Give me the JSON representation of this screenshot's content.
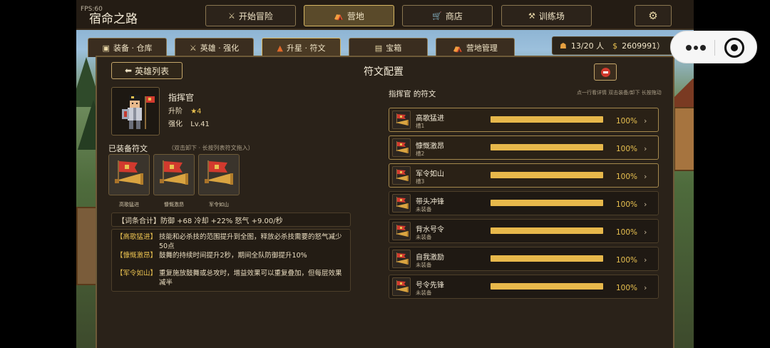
{
  "status": {
    "fps": "FPS:60"
  },
  "app": {
    "title": "宿命之路"
  },
  "top_nav": [
    {
      "label": "开始冒险",
      "icon": "crossed-swords-icon"
    },
    {
      "label": "营地",
      "icon": "camp-icon"
    },
    {
      "label": "商店",
      "icon": "cart-icon"
    },
    {
      "label": "训练场",
      "icon": "dumbbell-icon"
    }
  ],
  "settings_icon": "gear-icon",
  "sub_tabs": [
    {
      "label": "装备 · 仓库",
      "icon": "bag-icon"
    },
    {
      "label": "英雄 · 强化",
      "icon": "crossed-swords-icon"
    },
    {
      "label": "升星 · 符文",
      "icon": "flame-icon"
    },
    {
      "label": "宝箱",
      "icon": "chest-icon"
    },
    {
      "label": "营地管理",
      "icon": "camp-icon"
    }
  ],
  "resources": {
    "population": "13/20 人",
    "gold": "2609991）"
  },
  "panel": {
    "back_label": "英雄列表",
    "title": "符文配置"
  },
  "hero": {
    "name": "指挥官",
    "rank_label": "升阶",
    "rank_value": "★4",
    "level_label": "强化",
    "level_value": "Lv.41"
  },
  "equipped": {
    "title": "已装备符文",
    "hint": "（双击卸下 · 长按列表符文拖入）",
    "slots": [
      "高歌猛进",
      "慷慨激昂",
      "军令如山"
    ]
  },
  "summary": "【词条合计】防御 +68    冷却 +22%    怒气 +9.00/秒",
  "effects": [
    {
      "tag": "【高歌猛进】",
      "text": "技能和必杀技的范围提升到全图，释放必杀技需要的怒气减少50点"
    },
    {
      "tag": "【慷慨激昂】",
      "text": "鼓舞的持续时间提升2秒，期间全队防御提升10%"
    },
    {
      "tag": "【军令如山】",
      "text": "重复施放鼓舞或总攻时，增益效果可以重复叠加，但每层效果减半"
    }
  ],
  "rune_list": {
    "title": "指挥官 的符文",
    "hint": "点一行看详情    双击装备/卸下    长按拖动",
    "items": [
      {
        "name": "高歌猛进",
        "status": "槽1",
        "progress": 100,
        "pct_label": "100%",
        "equipped": true
      },
      {
        "name": "慷慨激昂",
        "status": "槽2",
        "progress": 100,
        "pct_label": "100%",
        "equipped": true
      },
      {
        "name": "军令如山",
        "status": "槽3",
        "progress": 100,
        "pct_label": "100%",
        "equipped": true
      },
      {
        "name": "带头冲锋",
        "status": "未装备",
        "progress": 100,
        "pct_label": "100%",
        "equipped": false
      },
      {
        "name": "背水号令",
        "status": "未装备",
        "progress": 100,
        "pct_label": "100%",
        "equipped": false
      },
      {
        "name": "自我激励",
        "status": "未装备",
        "progress": 100,
        "pct_label": "100%",
        "equipped": false
      },
      {
        "name": "号令先锋",
        "status": "未装备",
        "progress": 100,
        "pct_label": "100%",
        "equipped": false
      }
    ]
  },
  "colors": {
    "accent_gold": "#e7b84b",
    "panel_bg": "#2a2219",
    "border": "#8a7650"
  }
}
